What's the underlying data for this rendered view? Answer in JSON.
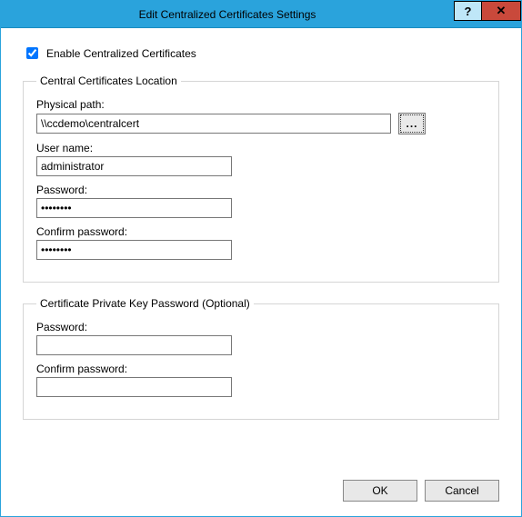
{
  "window": {
    "title": "Edit Centralized Certificates Settings",
    "help": "?",
    "close": "✕"
  },
  "enable": {
    "label": "Enable Centralized Certificates",
    "checked": true
  },
  "location": {
    "legend": "Central Certificates Location",
    "physicalPath": {
      "label": "Physical path:",
      "value": "\\\\ccdemo\\centralcert",
      "browse": "..."
    },
    "userName": {
      "label": "User name:",
      "value": "administrator"
    },
    "password": {
      "label": "Password:",
      "value": "••••••••"
    },
    "confirmPassword": {
      "label": "Confirm password:",
      "value": "••••••••"
    }
  },
  "privateKey": {
    "legend": "Certificate Private Key Password (Optional)",
    "password": {
      "label": "Password:",
      "value": ""
    },
    "confirmPassword": {
      "label": "Confirm password:",
      "value": ""
    }
  },
  "footer": {
    "ok": "OK",
    "cancel": "Cancel"
  }
}
